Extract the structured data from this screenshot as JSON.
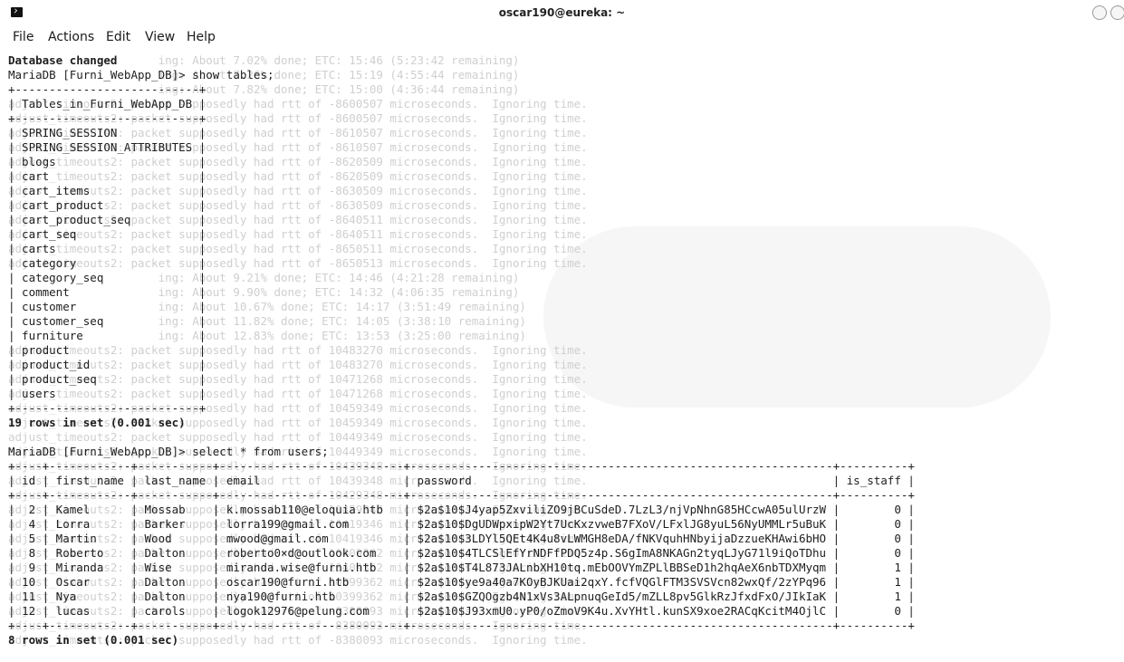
{
  "window": {
    "title": "oscar190@eureka: ~",
    "icon": "terminal-icon"
  },
  "menu": [
    "File",
    "Actions",
    "Edit",
    "View",
    "Help"
  ],
  "ghost_lines": [
    "                      ing: About 7.02% done; ETC: 15:46 (5:23:42 remaining)",
    "                      ing: About 7.26% done; ETC: 15:19 (4:55:44 remaining)",
    "                      ing: About 7.82% done; ETC: 15:00 (4:36:44 remaining)",
    "adjust_timeouts2: packet supposedly had rtt of -8600507 microseconds.  Ignoring time.",
    "adjust_timeouts2: packet supposedly had rtt of -8600507 microseconds.  Ignoring time.",
    "adjust_timeouts2: packet supposedly had rtt of -8610507 microseconds.  Ignoring time.",
    "adjust_timeouts2: packet supposedly had rtt of -8610507 microseconds.  Ignoring time.",
    "adjust_timeouts2: packet supposedly had rtt of -8620509 microseconds.  Ignoring time.",
    "adjust_timeouts2: packet supposedly had rtt of -8620509 microseconds.  Ignoring time.",
    "adjust_timeouts2: packet supposedly had rtt of -8630509 microseconds.  Ignoring time.",
    "adjust_timeouts2: packet supposedly had rtt of -8630509 microseconds.  Ignoring time.",
    "adjust_timeouts2: packet supposedly had rtt of -8640511 microseconds.  Ignoring time.",
    "adjust_timeouts2: packet supposedly had rtt of -8640511 microseconds.  Ignoring time.",
    "adjust_timeouts2: packet supposedly had rtt of -8650511 microseconds.  Ignoring time.",
    "adjust_timeouts2: packet supposedly had rtt of -8650513 microseconds.  Ignoring time.",
    "                      ing: About 9.21% done; ETC: 14:46 (4:21:28 remaining)",
    "                      ing: About 9.90% done; ETC: 14:32 (4:06:35 remaining)",
    "                      ing: About 10.67% done; ETC: 14:17 (3:51:49 remaining)",
    "                      ing: About 11.82% done; ETC: 14:05 (3:38:10 remaining)",
    "                      ing: About 12.83% done; ETC: 13:53 (3:25:00 remaining)",
    "adjust_timeouts2: packet supposedly had rtt of 10483270 microseconds.  Ignoring time.",
    "adjust_timeouts2: packet supposedly had rtt of 10483270 microseconds.  Ignoring time.",
    "adjust_timeouts2: packet supposedly had rtt of 10471268 microseconds.  Ignoring time.",
    "adjust_timeouts2: packet supposedly had rtt of 10471268 microseconds.  Ignoring time.",
    "adjust_timeouts2: packet supposedly had rtt of 10459349 microseconds.  Ignoring time.",
    "adjust_timeouts2: packet supposedly had rtt of 10459349 microseconds.  Ignoring time.",
    "adjust_timeouts2: packet supposedly had rtt of 10449349 microseconds.  Ignoring time.",
    "adjust_timeouts2: packet supposedly had rtt of 10449349 microseconds.  Ignoring time.",
    "adjust_timeouts2: packet supposedly had rtt of 10439348 microseconds.  Ignoring time.",
    "adjust_timeouts2: packet supposedly had rtt of 10439348 microseconds.  Ignoring time.",
    "adjust_timeouts2: packet supposedly had rtt of 10429348 microseconds.  Ignoring time.",
    "adjust_timeouts2: packet supposedly had rtt of 10429348 microseconds.  Ignoring time.",
    "adjust_timeouts2: packet supposedly had rtt of 10419346 microseconds.  Ignoring time.",
    "adjust_timeouts2: packet supposedly had rtt of 10419346 microseconds.  Ignoring time.",
    "adjust_timeouts2: packet supposedly had rtt of 10409362 microseconds.  Ignoring time.",
    "adjust_timeouts2: packet supposedly had rtt of 10409362 microseconds.  Ignoring time.",
    "adjust_timeouts2: packet supposedly had rtt of 10399362 microseconds.  Ignoring time.",
    "adjust_timeouts2: packet supposedly had rtt of 10399362 microseconds.  Ignoring time.",
    "adjust_timeouts2: packet supposedly had rtt of -8380093 microseconds.  Ignoring time.",
    "adjust_timeouts2: packet supposedly had rtt of -8380093 microseconds.  Ignoring time.",
    "adjust_timeouts2: packet supposedly had rtt of -8380093 microseconds.  Ignoring time."
  ],
  "terminal_lines": [
    {
      "text": "Database changed",
      "bold": true
    },
    {
      "text": "MariaDB [Furni_WebApp_DB]> show tables;"
    },
    {
      "text": "+---------------------------+"
    },
    {
      "text": "| Tables_in_Furni_WebApp_DB |"
    },
    {
      "text": "+---------------------------+"
    },
    {
      "text": "| SPRING_SESSION            |"
    },
    {
      "text": "| SPRING_SESSION_ATTRIBUTES |"
    },
    {
      "text": "| blogs                     |"
    },
    {
      "text": "| cart                      |"
    },
    {
      "text": "| cart_items                |"
    },
    {
      "text": "| cart_product              |"
    },
    {
      "text": "| cart_product_seq          |"
    },
    {
      "text": "| cart_seq                  |"
    },
    {
      "text": "| carts                     |"
    },
    {
      "text": "| category                  |"
    },
    {
      "text": "| category_seq              |"
    },
    {
      "text": "| comment                   |"
    },
    {
      "text": "| customer                  |"
    },
    {
      "text": "| customer_seq              |"
    },
    {
      "text": "| furniture                 |"
    },
    {
      "text": "| product                   |"
    },
    {
      "text": "| product_id                |"
    },
    {
      "text": "| product_seq               |"
    },
    {
      "text": "| users                     |"
    },
    {
      "text": "+---------------------------+"
    },
    {
      "text": "19 rows in set (0.001 sec)",
      "bold": true
    },
    {
      "text": ""
    },
    {
      "text": "MariaDB [Furni_WebApp_DB]> select * from users;"
    },
    {
      "text": "+----+------------+-----------+---------------------------+--------------------------------------------------------------+----------+"
    },
    {
      "text": "| id | first_name | last_name | email                     | password                                                     | is_staff |"
    },
    {
      "text": "+----+------------+-----------+---------------------------+--------------------------------------------------------------+----------+"
    },
    {
      "text": "|  2 | Kamel      | Mossab    | k.mossab110@eloquia.htb   | $2a$10$J4yap5ZxviliZO9jBCuSdeD.7LzL3/njVpNhnG85HCcwA05ulUrzW |        0 |"
    },
    {
      "text": "|  4 | Lorra      | Barker    | lorra199@gmail.com        | $2a$10$DgUDWpxipW2Yt7UcKxzvweB7FXoV/LFxlJG8yuL56NyUMMLr5uBuK |        0 |"
    },
    {
      "text": "|  5 | Martin     | Wood      | mwood@gmail.com           | $2a$10$3LDYl5QEt4K4u8vLWMGH8eDA/fNKVquhHNbyijaDzzueKHAwi6bHO |        0 |"
    },
    {
      "text": "|  8 | Roberto    | Dalton    | roberto0×d@outlook.com    | $2a$10$4TLCSlEfYrNDFfPDQ5z4p.S6gImA8NKAGn2tyqLJyG71l9iQoTDhu |        0 |"
    },
    {
      "text": "|  9 | Miranda    | Wise      | miranda.wise@furni.htb    | $2a$10$T4L873JALnbXH10tq.mEbOOVYmZPLlBBSeD1h2hqAeX6nbTDXMyqm |        1 |"
    },
    {
      "text": "| 10 | Oscar      | Dalton    | oscar190@furni.htb        | $2a$10$ye9a40a7KOyBJKUai2qxY.fcfVQGlFTM3SVSVcn82wxQf/2zYPq96 |        1 |"
    },
    {
      "text": "| 11 | Nya        | Dalton    | nya190@furni.htb          | $2a$10$GZQOgzb4N1xVs3ALpnuqGeId5/mZLL8pv5GlkRzJfxdFxO/JIkIaK |        1 |"
    },
    {
      "text": "| 12 | lucas      | carols    | logok12976@pelung.com     | $2a$10$J93xmU0.yP0/oZmoV9K4u.XvYHtl.kunSX9xoe2RACqKcitM4OjlC |        0 |"
    },
    {
      "text": "+----+------------+-----------+---------------------------+--------------------------------------------------------------+----------+"
    },
    {
      "text": "8 rows in set (0.001 sec)",
      "bold": true
    },
    {
      "text": ""
    }
  ]
}
